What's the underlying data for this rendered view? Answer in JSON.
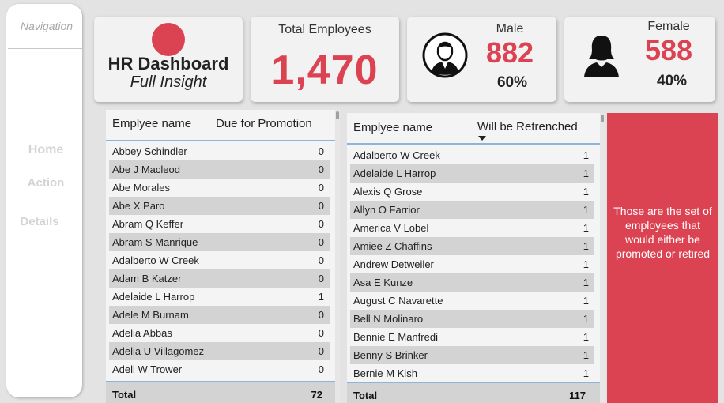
{
  "navigation": {
    "title": "Navigation",
    "items": [
      "Home",
      "Action",
      "Details"
    ]
  },
  "header_card": {
    "title": "HR Dashboard",
    "subtitle": "Full Insight"
  },
  "total_card": {
    "label": "Total Employees",
    "value": "1,470"
  },
  "male_card": {
    "label": "Male",
    "value": "882",
    "percent": "60%"
  },
  "female_card": {
    "label": "Female",
    "value": "588",
    "percent": "40%"
  },
  "promotion_table": {
    "col_name": "Emplyee name",
    "col_value": "Due for Promotion",
    "rows": [
      [
        "Abbey Schindler",
        "0"
      ],
      [
        "Abe J Macleod",
        "0"
      ],
      [
        "Abe Morales",
        "0"
      ],
      [
        "Abe X Paro",
        "0"
      ],
      [
        "Abram Q Keffer",
        "0"
      ],
      [
        "Abram S Manrique",
        "0"
      ],
      [
        "Adalberto W Creek",
        "0"
      ],
      [
        "Adam B Katzer",
        "0"
      ],
      [
        "Adelaide L Harrop",
        "1"
      ],
      [
        "Adele M Burnam",
        "0"
      ],
      [
        "Adelia Abbas",
        "0"
      ],
      [
        "Adelia U Villagomez",
        "0"
      ],
      [
        "Adell W Trower",
        "0"
      ]
    ],
    "total_label": "Total",
    "total_value": "72"
  },
  "retrench_table": {
    "col_name": "Emplyee name",
    "col_value": "Will be Retrenched",
    "rows": [
      [
        "Adalberto W Creek",
        "1"
      ],
      [
        "Adelaide L Harrop",
        "1"
      ],
      [
        "Alexis Q Grose",
        "1"
      ],
      [
        "Allyn O Farrior",
        "1"
      ],
      [
        "America V Lobel",
        "1"
      ],
      [
        "Amiee Z Chaffins",
        "1"
      ],
      [
        "Andrew Detweiler",
        "1"
      ],
      [
        "Asa E Kunze",
        "1"
      ],
      [
        "August C Navarette",
        "1"
      ],
      [
        "Bell N Molinaro",
        "1"
      ],
      [
        "Bennie E Manfredi",
        "1"
      ],
      [
        "Benny S Brinker",
        "1"
      ],
      [
        "Bernie M Kish",
        "1"
      ]
    ],
    "total_label": "Total",
    "total_value": "117"
  },
  "info_panel": {
    "text": "Those are the set of employees that would either be promoted or retired"
  },
  "colors": {
    "accent": "#dc4352",
    "background": "#e3e3e3",
    "card": "#f2f2f2",
    "row_alt": "#d3d3d3"
  },
  "icons": {
    "male": "male-avatar-icon",
    "female": "female-avatar-icon",
    "sort": "sort-descending-icon"
  }
}
